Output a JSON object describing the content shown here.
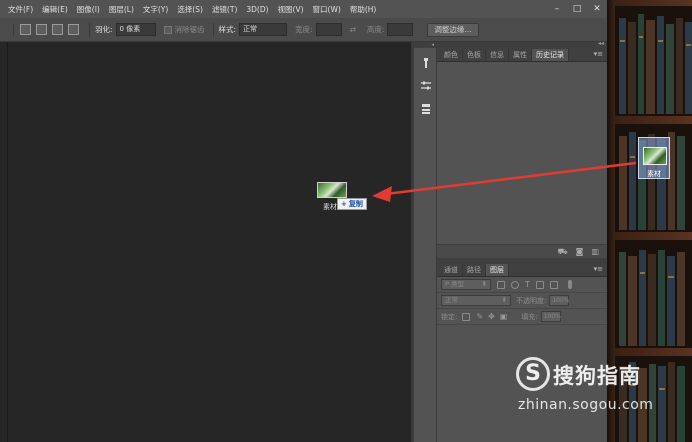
{
  "menu": {
    "items": [
      "文件(F)",
      "编辑(E)",
      "图像(I)",
      "图层(L)",
      "文字(Y)",
      "选择(S)",
      "滤镜(T)",
      "3D(D)",
      "视图(V)",
      "窗口(W)",
      "帮助(H)"
    ],
    "window_controls": [
      "–",
      "□",
      "✕"
    ]
  },
  "options_bar": {
    "feather_label": "羽化:",
    "feather_value": "0 像素",
    "antialias_label": "消除锯齿",
    "style_label": "样式:",
    "style_value": "正常",
    "width_label": "宽度:",
    "height_label": "高度:",
    "refine_edge_button": "调整边缘..."
  },
  "panels": {
    "top_tabs": [
      "颜色",
      "色板",
      "信息",
      "属性",
      "历史记录"
    ],
    "top_active": "历史记录",
    "layer_tabs": [
      "通道",
      "路径",
      "图层"
    ],
    "layer_active": "图层",
    "kind_filter": "P 类型",
    "blend_mode": "正常",
    "opacity_label": "不透明度:",
    "opacity_value": "100%",
    "lock_label": "锁定:",
    "fill_label": "填充:",
    "fill_value": "100%"
  },
  "drag": {
    "file_name": "素材",
    "canvas_name": "素材",
    "tooltip": "复制",
    "tooltip_icon": "+"
  },
  "watermark": {
    "logo": "S",
    "title": "搜狗指南",
    "url": "zhinan.sogou.com"
  },
  "colors": {
    "arrow": "#e23b34",
    "tooltip_text": "#1c4fb4"
  }
}
